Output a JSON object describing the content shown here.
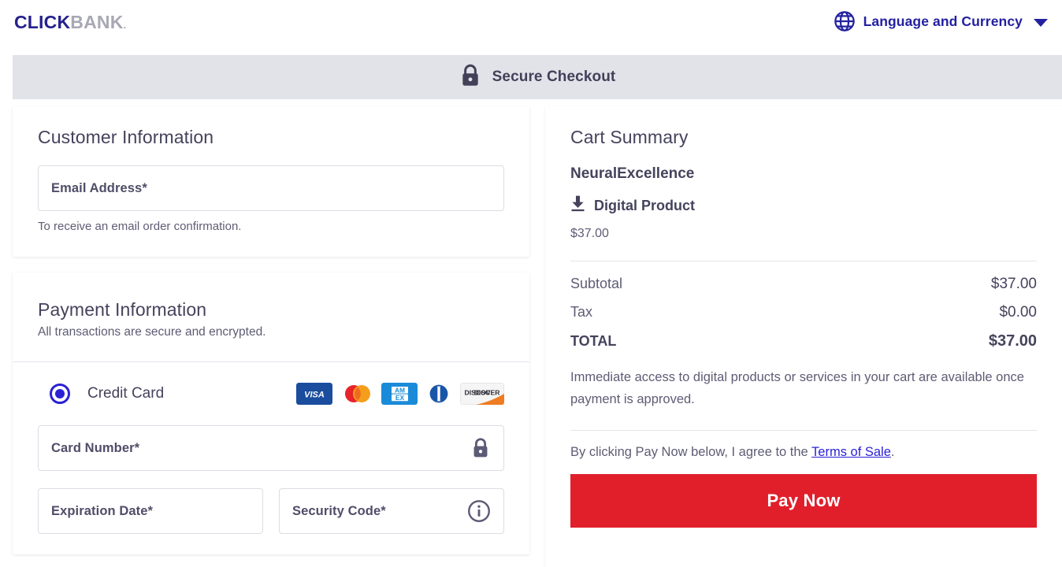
{
  "header": {
    "logo_primary": "CLICK",
    "logo_secondary": "BANK",
    "logo_tm": ".",
    "language_label": "Language and Currency",
    "globe_icon": "globe-icon",
    "caret_icon": "chevron-down-icon"
  },
  "secure_band": {
    "label": "Secure Checkout",
    "icon": "lock-icon",
    "background": "#e2e2e9"
  },
  "customer": {
    "title": "Customer Information",
    "email_placeholder": "Email Address*",
    "email_value": "",
    "helper": "To receive an email order confirmation."
  },
  "payment": {
    "title": "Payment Information",
    "subtitle": "All transactions are secure and encrypted.",
    "method_label": "Credit Card",
    "method_selected": true,
    "brands": [
      {
        "name": "visa",
        "label": "VISA"
      },
      {
        "name": "mastercard",
        "label": "Mastercard"
      },
      {
        "name": "amex",
        "label": "AMEX"
      },
      {
        "name": "diners-club",
        "label": "Diners Club"
      },
      {
        "name": "discover",
        "label": "DISCOVER"
      }
    ],
    "card_number_placeholder": "Card Number*",
    "card_number_value": "",
    "card_number_icon": "lock-icon",
    "expiration_placeholder": "Expiration Date*",
    "expiration_value": "",
    "security_code_placeholder": "Security Code*",
    "security_code_value": "",
    "security_code_icon": "info-circle-icon"
  },
  "cart": {
    "title": "Cart Summary",
    "product_name": "NeuralExcellence",
    "product_type": "Digital Product",
    "product_type_icon": "download-icon",
    "product_price": "$37.00",
    "lines": [
      {
        "label": "Subtotal",
        "amount": "$37.00"
      },
      {
        "label": "Tax",
        "amount": "$0.00"
      }
    ],
    "total_label": "TOTAL",
    "total_amount": "$37.00",
    "access_note": "Immediate access to digital products or services in your cart are available once payment is approved.",
    "terms_prefix": "By clicking Pay Now below, I agree to the ",
    "terms_link": "Terms of Sale",
    "terms_suffix": ".",
    "pay_button": "Pay Now",
    "pay_button_color": "#e01f2b"
  }
}
